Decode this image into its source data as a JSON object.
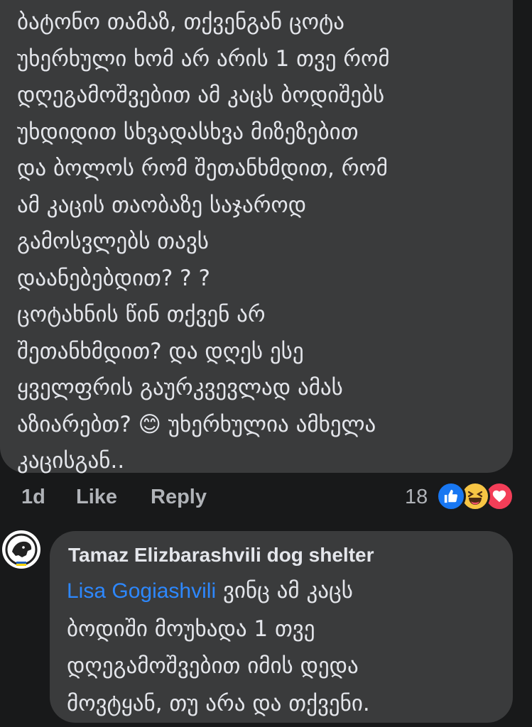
{
  "comment1": {
    "lines": [
      "ბატონო თამაზ, თქვენგან ცოტა",
      "უხერხული ხომ არ არის 1 თვე რომ",
      "დღეგამოშვებით ამ კაცს ბოდიშებს",
      "უხდიდით სხვადასხვა მიზეზებით",
      "და ბოლოს რომ შეთანხმდით, რომ",
      "ამ კაცის თაობაზე საჯაროდ",
      "გამოსვლებს თავს",
      "დაანებებდით? ? ?",
      "ცოტახნის წინ თქვენ არ",
      "შეთანხმდით? და დღეს ესე",
      "ყველფრის გაურკვევლად ამას",
      "აზიარებთ? 😊 უხერხულია ამხელა",
      "კაცისგან.."
    ],
    "timestamp": "1d",
    "like_label": "Like",
    "reply_label": "Reply",
    "reaction_count": "18",
    "reactions": [
      "like-icon",
      "haha-icon",
      "love-icon"
    ]
  },
  "reply1": {
    "author": "Tamaz Elizbarashvili dog shelter",
    "mention": "Lisa Gogiashvili",
    "first_line_rest": " ვინც ამ კაცს",
    "lines": [
      "ბოდიში მოუხადა 1 თვე",
      "დღეგამოშვებით იმის დედა",
      "მოვტყან, თუ არა და თქვენი."
    ]
  },
  "colors": {
    "background": "#18191a",
    "bubble": "#3a3b3c",
    "text": "#e4e6eb",
    "secondary_text": "#b0b3b8",
    "mention": "#2d88ff",
    "like_blue": "#1877f2",
    "love_red": "#f33e58",
    "haha_yellow": "#f7c544"
  }
}
